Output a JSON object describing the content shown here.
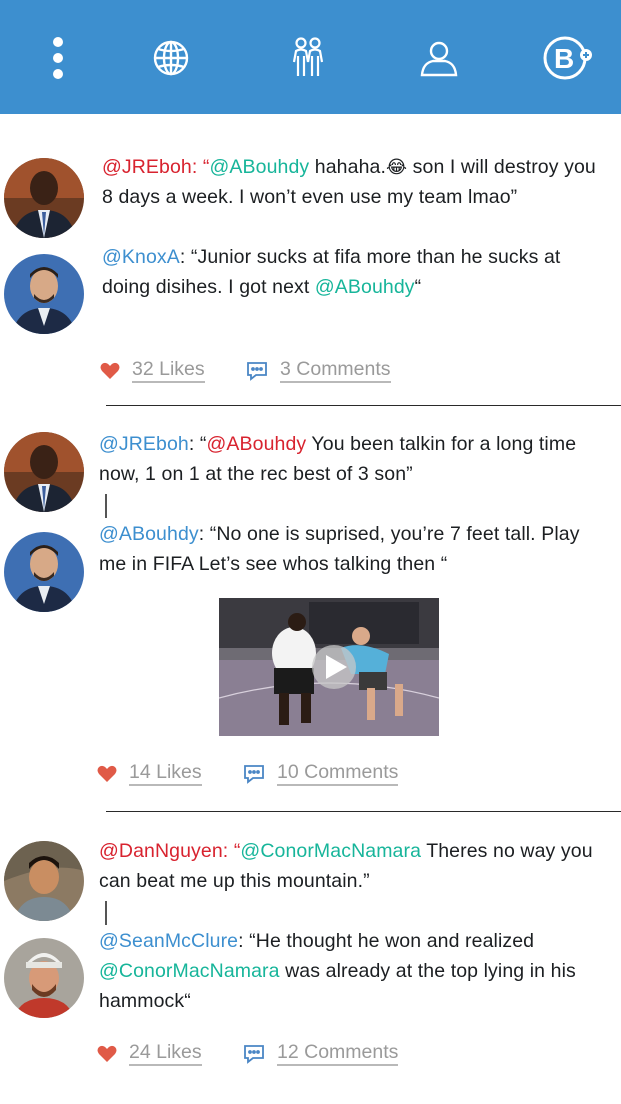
{
  "nav": {
    "menu_icon": "dots-vertical-icon",
    "explore_icon": "globe-icon",
    "friends_icon": "people-icon",
    "profile_icon": "person-icon",
    "brand_icon": "b-plus-icon"
  },
  "colors": {
    "topbar": "#3d8fcf",
    "mention_red": "#d8232f",
    "mention_teal": "#17b59a",
    "mention_blue": "#3d8fcf",
    "heart": "#e05a47"
  },
  "posts": [
    {
      "msg1": {
        "author": "@JREboh",
        "sep": ": “",
        "mention": "@ABouhdy",
        "text1": " hahaha.",
        "emoji": "😂",
        "text2": "  son I will destroy you 8 days a week. I won’t even use my team lmao”"
      },
      "msg2": {
        "author": "@KnoxA",
        "sep": ": “Junior sucks at fifa more than he sucks at doing disihes. I got next ",
        "mention": "@ABouhdy",
        "text": "“"
      },
      "likes": "32 Likes",
      "comments": "3 Comments"
    },
    {
      "msg1": {
        "author": "@JREboh",
        "sep": ": “",
        "mention": "@ABouhdy",
        "text": " You been talkin for a long time now, 1 on 1 at the rec best of 3 son”"
      },
      "msg2": {
        "author": "@ABouhdy",
        "text": ": “No one is suprised, you’re 7 feet tall. Play me in FIFA Let’s see whos talking then “"
      },
      "likes": "14 Likes",
      "comments": "10 Comments"
    },
    {
      "msg1": {
        "author": "@DanNguyen",
        "sep": ": “",
        "mention": "@ConorMacNamara",
        "text": " Theres no way you can beat me up this mountain.”"
      },
      "msg2": {
        "author": "@SeanMcClure",
        "sep": ": “He thought he won and realized ",
        "mention": "@ConorMacNamara",
        "text": " was already at the top lying in his hammock“"
      },
      "likes": "24 Likes",
      "comments": "12 Comments"
    }
  ]
}
